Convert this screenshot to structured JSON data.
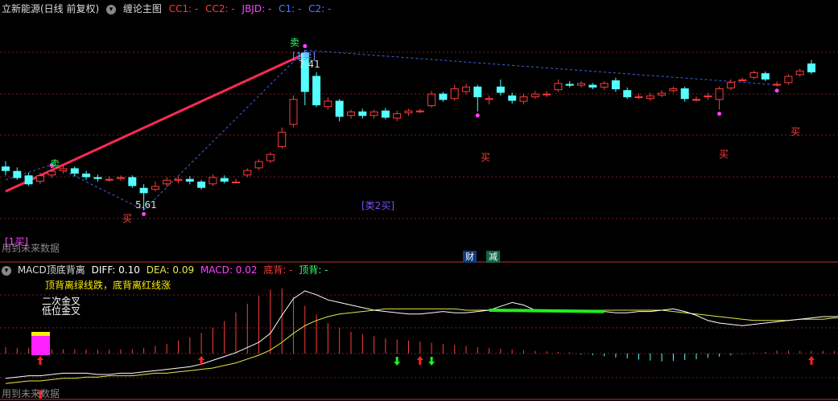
{
  "main_header": {
    "stock_title": "立新能源(日线 前复权)",
    "indicator_name": "缠论主图",
    "cc1_label": "CC1: -",
    "cc2_label": "CC2: -",
    "jbjd_label": "JBJD: -",
    "c1_label": "C1: -",
    "c2_label": "C2: -"
  },
  "sub_header": {
    "indicator_name": "MACD顶底背离",
    "diff": "DIFF: 0.10",
    "dea": "DEA: 0.09",
    "macd": "MACD: 0.02",
    "dibei": "底背: -",
    "dingbei": "顶背: -"
  },
  "annotations": {
    "future_data": "用到未来数据",
    "future_data_sub": "用到未来数据",
    "high_price": "7.41",
    "low_price": "5.61",
    "buy1_bracket": "[1买]",
    "sell1_bracket": "[1卖]",
    "buy2_bracket": "[类2买]",
    "sell_label": "卖",
    "buy_label": "买",
    "note_line1": "顶背离绿线跌，底背离红线涨",
    "note_line2": "二次金叉",
    "note_line3": "低位金叉",
    "badge_cai": "财",
    "badge_jian": "减"
  },
  "colors": {
    "up": "#ff3c3c",
    "down": "#54ffff",
    "magenta": "#ff44ff",
    "dea_line": "#e8e84c",
    "diff_line": "#ffffff",
    "trend": "#ff2a55",
    "dash": "#3d66e6",
    "green": "#22ee22"
  },
  "chart_data": {
    "type": "candlestick",
    "candles": [
      [
        6.1,
        6.05,
        6.16,
        6.0
      ],
      [
        6.05,
        5.97,
        6.09,
        5.95
      ],
      [
        6.0,
        5.9,
        6.03,
        5.88
      ],
      [
        5.93,
        6.0,
        6.03,
        5.9
      ],
      [
        6.0,
        6.05,
        6.07,
        5.97
      ],
      [
        6.05,
        6.08,
        6.12,
        6.02
      ],
      [
        6.08,
        6.02,
        6.1,
        5.99
      ],
      [
        6.02,
        5.98,
        6.05,
        5.95
      ],
      [
        5.98,
        5.96,
        6.01,
        5.93
      ],
      [
        5.96,
        5.96,
        5.99,
        5.93
      ],
      [
        5.96,
        5.98,
        6.0,
        5.94
      ],
      [
        5.98,
        5.88,
        6.0,
        5.86
      ],
      [
        5.86,
        5.8,
        5.9,
        5.61
      ],
      [
        5.84,
        5.88,
        5.93,
        5.82
      ],
      [
        5.9,
        5.95,
        5.98,
        5.87
      ],
      [
        5.94,
        5.96,
        5.99,
        5.91
      ],
      [
        5.96,
        5.93,
        5.99,
        5.9
      ],
      [
        5.93,
        5.86,
        5.95,
        5.84
      ],
      [
        5.9,
        5.98,
        6.01,
        5.88
      ],
      [
        5.97,
        5.93,
        6.0,
        5.91
      ],
      [
        5.93,
        5.93,
        5.96,
        5.91
      ],
      [
        6.0,
        6.06,
        6.08,
        5.98
      ],
      [
        6.08,
        6.16,
        6.18,
        6.06
      ],
      [
        6.16,
        6.24,
        6.26,
        6.14
      ],
      [
        6.32,
        6.49,
        6.54,
        6.3
      ],
      [
        6.57,
        6.86,
        6.9,
        6.54
      ],
      [
        7.38,
        6.94,
        7.41,
        6.79
      ],
      [
        7.12,
        6.79,
        7.16,
        6.77
      ],
      [
        6.77,
        6.84,
        6.88,
        6.74
      ],
      [
        6.84,
        6.66,
        6.86,
        6.61
      ],
      [
        6.67,
        6.72,
        6.74,
        6.64
      ],
      [
        6.72,
        6.67,
        6.75,
        6.64
      ],
      [
        6.67,
        6.72,
        6.74,
        6.64
      ],
      [
        6.73,
        6.65,
        6.76,
        6.63
      ],
      [
        6.64,
        6.7,
        6.73,
        6.61
      ],
      [
        6.7,
        6.73,
        6.75,
        6.67
      ],
      [
        6.73,
        6.73,
        6.75,
        6.7
      ],
      [
        6.78,
        6.92,
        6.95,
        6.76
      ],
      [
        6.92,
        6.85,
        6.94,
        6.83
      ],
      [
        6.86,
        6.98,
        7.02,
        6.84
      ],
      [
        6.94,
        7.0,
        7.03,
        6.91
      ],
      [
        7.0,
        6.88,
        7.02,
        6.72
      ],
      [
        6.85,
        6.87,
        6.9,
        6.8
      ],
      [
        7.0,
        6.93,
        7.08,
        6.9
      ],
      [
        6.9,
        6.84,
        6.93,
        6.81
      ],
      [
        6.83,
        6.89,
        6.92,
        6.8
      ],
      [
        6.88,
        6.92,
        6.95,
        6.86
      ],
      [
        6.92,
        6.92,
        6.95,
        6.88
      ],
      [
        6.96,
        7.04,
        7.08,
        6.94
      ],
      [
        7.03,
        7.01,
        7.06,
        6.99
      ],
      [
        7.01,
        7.04,
        7.06,
        6.99
      ],
      [
        7.02,
        6.99,
        7.04,
        6.97
      ],
      [
        6.99,
        7.04,
        7.06,
        6.96
      ],
      [
        7.07,
        6.97,
        7.1,
        6.94
      ],
      [
        6.96,
        6.88,
        6.99,
        6.86
      ],
      [
        6.89,
        6.89,
        6.92,
        6.86
      ],
      [
        6.86,
        6.9,
        6.93,
        6.84
      ],
      [
        6.9,
        6.93,
        6.96,
        6.88
      ],
      [
        6.95,
        6.98,
        7.0,
        6.93
      ],
      [
        6.98,
        6.86,
        7.0,
        6.83
      ],
      [
        6.86,
        6.86,
        6.89,
        6.83
      ],
      [
        6.88,
        6.9,
        6.93,
        6.85
      ],
      [
        6.85,
        6.98,
        7.0,
        6.74
      ],
      [
        6.98,
        7.05,
        7.08,
        6.96
      ],
      [
        7.08,
        7.08,
        7.1,
        7.06
      ],
      [
        7.1,
        7.16,
        7.18,
        7.08
      ],
      [
        7.15,
        7.08,
        7.17,
        7.06
      ],
      [
        7.03,
        7.03,
        7.06,
        7.0
      ],
      [
        7.04,
        7.12,
        7.14,
        7.02
      ],
      [
        7.13,
        7.18,
        7.2,
        7.11
      ],
      [
        7.26,
        7.16,
        7.3,
        7.14
      ]
    ],
    "markers": [
      {
        "type": "sell",
        "index": 4
      },
      {
        "type": "buy",
        "index": 12
      },
      {
        "type": "sell",
        "index": 26
      },
      {
        "type": "buy",
        "index": 41
      },
      {
        "type": "buy",
        "index": 62
      },
      {
        "type": "buy",
        "index": 67
      }
    ],
    "sub": {
      "hist": [
        0.03,
        0.025,
        0.025,
        0.022,
        0.02,
        0.02,
        0.019,
        0.018,
        0.018,
        0.018,
        0.019,
        0.02,
        0.025,
        0.035,
        0.045,
        0.06,
        0.075,
        0.095,
        0.12,
        0.15,
        0.19,
        0.23,
        0.265,
        0.295,
        0.3,
        0.26,
        0.22,
        0.18,
        0.14,
        0.12,
        0.1,
        0.09,
        0.08,
        0.07,
        0.065,
        0.06,
        0.055,
        0.05,
        0.045,
        0.04,
        0.035,
        0.03,
        0.025,
        0.022,
        0.018,
        0.015,
        0.012,
        0.01,
        0.008,
        0.006,
        -0.004,
        -0.008,
        -0.012,
        -0.018,
        -0.022,
        -0.028,
        -0.032,
        -0.036,
        -0.034,
        -0.03,
        -0.026,
        -0.02,
        -0.014,
        -0.008,
        -0.002,
        0.004,
        0.008,
        0.014,
        0.014,
        0.012,
        0.012,
        0.012,
        0.012,
        0.01,
        0.01,
        0.01
      ],
      "diff": [
        -0.38,
        -0.37,
        -0.36,
        -0.36,
        -0.35,
        -0.34,
        -0.34,
        -0.34,
        -0.35,
        -0.35,
        -0.34,
        -0.34,
        -0.33,
        -0.32,
        -0.31,
        -0.3,
        -0.29,
        -0.27,
        -0.24,
        -0.21,
        -0.18,
        -0.14,
        -0.1,
        -0.03,
        0.11,
        0.24,
        0.3,
        0.27,
        0.23,
        0.21,
        0.19,
        0.17,
        0.15,
        0.14,
        0.13,
        0.12,
        0.12,
        0.13,
        0.14,
        0.13,
        0.13,
        0.14,
        0.15,
        0.18,
        0.21,
        0.19,
        0.15,
        0.14,
        0.14,
        0.15,
        0.14,
        0.14,
        0.14,
        0.13,
        0.13,
        0.14,
        0.14,
        0.15,
        0.16,
        0.14,
        0.11,
        0.07,
        0.05,
        0.04,
        0.03,
        0.04,
        0.05,
        0.06,
        0.07,
        0.08,
        0.09,
        0.1,
        0.1,
        0.11,
        0.1,
        0.1
      ],
      "dea": [
        -0.42,
        -0.41,
        -0.4,
        -0.4,
        -0.39,
        -0.38,
        -0.38,
        -0.37,
        -0.37,
        -0.36,
        -0.36,
        -0.36,
        -0.35,
        -0.34,
        -0.34,
        -0.33,
        -0.32,
        -0.31,
        -0.3,
        -0.28,
        -0.26,
        -0.23,
        -0.2,
        -0.16,
        -0.1,
        -0.03,
        0.03,
        0.07,
        0.1,
        0.12,
        0.13,
        0.14,
        0.15,
        0.16,
        0.16,
        0.16,
        0.16,
        0.16,
        0.16,
        0.16,
        0.15,
        0.15,
        0.15,
        0.15,
        0.15,
        0.15,
        0.15,
        0.15,
        0.15,
        0.15,
        0.15,
        0.15,
        0.15,
        0.15,
        0.15,
        0.15,
        0.15,
        0.15,
        0.14,
        0.13,
        0.12,
        0.11,
        0.1,
        0.09,
        0.08,
        0.07,
        0.07,
        0.07,
        0.07,
        0.08,
        0.08,
        0.08,
        0.09,
        0.09,
        0.09,
        0.09
      ],
      "up_arrows": [
        2,
        21,
        55,
        73
      ],
      "down_arrows": [
        19,
        22,
        58
      ],
      "green_segment": [
        25,
        35
      ]
    }
  }
}
